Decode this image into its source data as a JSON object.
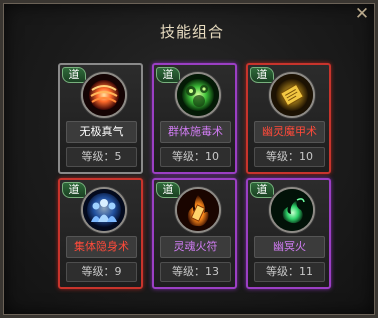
{
  "dialog": {
    "title": "技能组合",
    "close_glyph": "✕"
  },
  "colors": {
    "gold": "#c9a22b",
    "purple": "#9b3fc4",
    "red": "#c8342c",
    "name_white": "#ffffff",
    "name_purple": "#d07cf2",
    "name_red": "#ff4a3a"
  },
  "skills": [
    {
      "badge": "道",
      "name": "无极真气",
      "level": "等级：5",
      "frame": "gold",
      "name_color": "#ffffff",
      "icon": "red-spiral-orb-icon"
    },
    {
      "badge": "道",
      "name": "群体施毒术",
      "level": "等级：10",
      "frame": "purple",
      "name_color": "#d07cf2",
      "icon": "green-poison-cloud-icon"
    },
    {
      "badge": "道",
      "name": "幽灵魔甲术",
      "level": "等级：10",
      "frame": "red",
      "name_color": "#ff4a3a",
      "icon": "golden-talisman-icon"
    },
    {
      "badge": "道",
      "name": "集体隐身术",
      "level": "等级：9",
      "frame": "red",
      "name_color": "#ff4a3a",
      "icon": "blue-figures-icon"
    },
    {
      "badge": "道",
      "name": "灵魂火符",
      "level": "等级：13",
      "frame": "purple",
      "name_color": "#d07cf2",
      "icon": "fire-talisman-icon"
    },
    {
      "badge": "道",
      "name": "幽冥火",
      "level": "等级：11",
      "frame": "purple",
      "name_color": "#d07cf2",
      "icon": "green-flame-icon"
    }
  ]
}
